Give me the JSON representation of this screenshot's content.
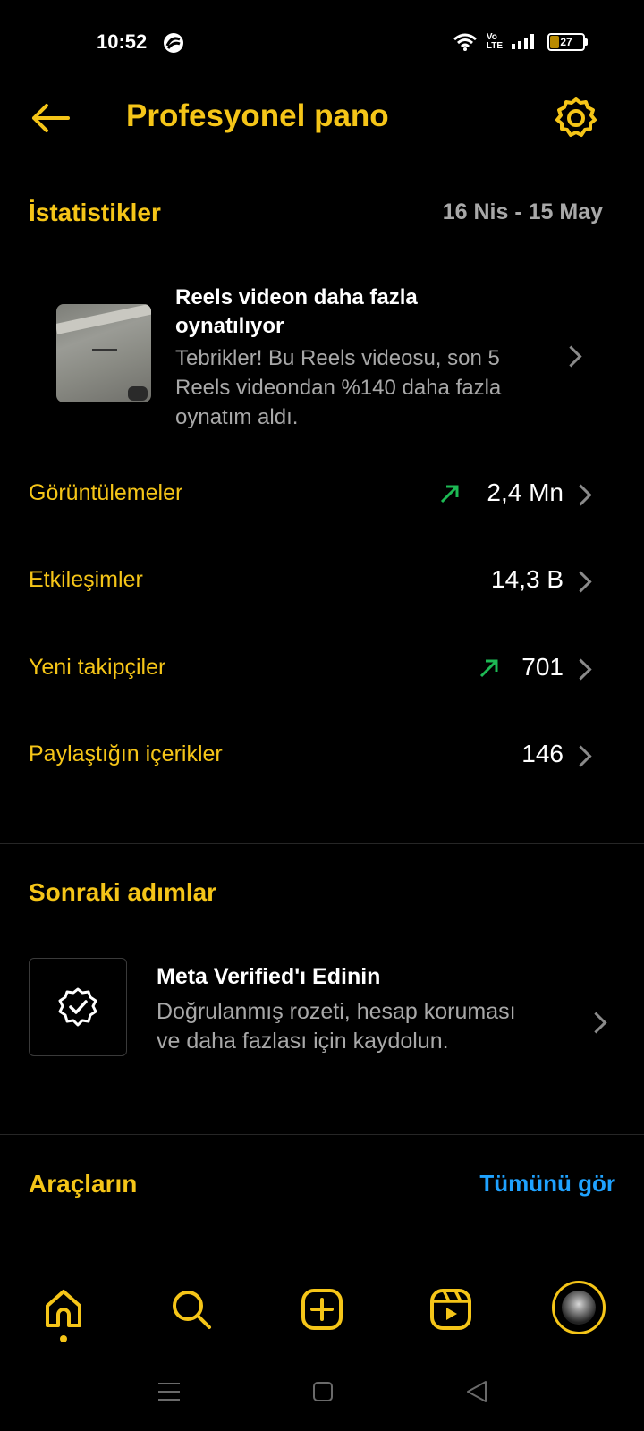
{
  "status_bar": {
    "time": "10:52",
    "network_label": "Vo\nLTE",
    "battery": "27",
    "battery_fraction": 0.27
  },
  "header": {
    "title": "Profesyonel pano",
    "back_icon": "arrow-left-icon",
    "settings_icon": "gear-icon"
  },
  "statistics": {
    "title": "İstatistikler",
    "date_range": "16 Nis - 15 May",
    "highlight": {
      "title": "Reels videon daha fazla oynatılıyor",
      "description": "Tebrikler! Bu Reels videosu, son 5 Reels videondan %140 daha fazla oynatım aldı."
    },
    "metrics": [
      {
        "label": "Görüntülemeler",
        "value": "2,4 Mn",
        "trend": "up"
      },
      {
        "label": "Etkileşimler",
        "value": "14,3 B",
        "trend": "none"
      },
      {
        "label": "Yeni takipçiler",
        "value": "701",
        "trend": "up"
      },
      {
        "label": "Paylaştığın içerikler",
        "value": "146",
        "trend": "none"
      }
    ]
  },
  "next_steps": {
    "title": "Sonraki adımlar",
    "meta": {
      "title": "Meta Verified'ı Edinin",
      "description": "Doğrulanmış rozeti, hesap koruması ve daha fazlası için kaydolun."
    }
  },
  "tools": {
    "title": "Araçların",
    "see_all": "Tümünü gör"
  },
  "bottom_nav": {
    "items": [
      "home-icon",
      "search-icon",
      "create-icon",
      "reels-icon",
      "profile-avatar"
    ],
    "active": "home-icon"
  },
  "colors": {
    "accent": "#f5c518",
    "link": "#1fa2ff",
    "trend_up": "#1db954",
    "background": "#000000"
  }
}
